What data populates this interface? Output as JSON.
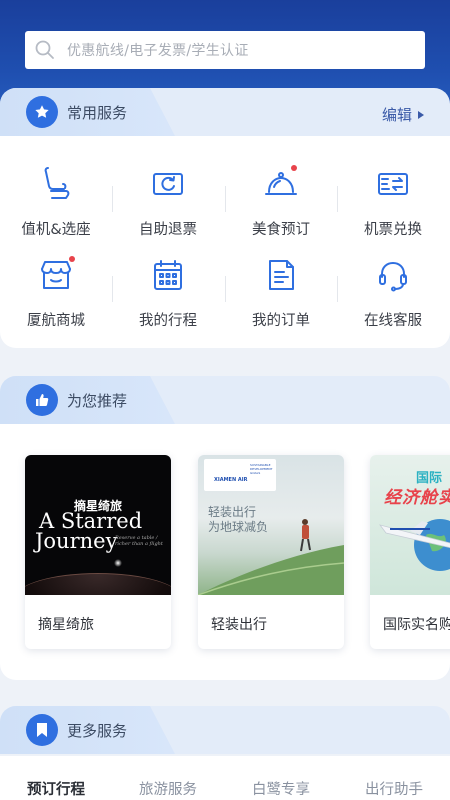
{
  "search": {
    "placeholder": "优惠航线/电子发票/学生认证"
  },
  "common_services": {
    "title": "常用服务",
    "edit_label": "编辑",
    "items": [
      {
        "label": "值机&选座",
        "icon": "seat-icon",
        "badge": false
      },
      {
        "label": "自助退票",
        "icon": "refund-ticket-icon",
        "badge": false
      },
      {
        "label": "美食预订",
        "icon": "food-cloche-icon",
        "badge": true
      },
      {
        "label": "机票兑换",
        "icon": "ticket-exchange-icon",
        "badge": false
      },
      {
        "label": "厦航商城",
        "icon": "shop-icon",
        "badge": true
      },
      {
        "label": "我的行程",
        "icon": "calendar-icon",
        "badge": false
      },
      {
        "label": "我的订单",
        "icon": "order-document-icon",
        "badge": false
      },
      {
        "label": "在线客服",
        "icon": "headset-icon",
        "badge": false
      }
    ]
  },
  "recommend": {
    "title": "为您推荐",
    "cards": [
      {
        "label": "摘星绮旅",
        "image_text": {
          "cn": "摘星绮旅",
          "en1": "A Starred",
          "en2": "Journey",
          "sub": "Reserve a table / richer than a flight"
        }
      },
      {
        "label": "轻装出行",
        "image_text": {
          "cn1": "轻装出行",
          "cn2": "为地球减负",
          "badge": "SUSTAINABLE DEVELOPMENT GOALS",
          "brand": "XIAMEN AIR"
        }
      },
      {
        "label": "国际实名购",
        "image_text": {
          "cn1": "国际",
          "cn2": "经济舱实"
        }
      }
    ]
  },
  "more_services": {
    "title": "更多服务",
    "tabs": [
      "预订行程",
      "旅游服务",
      "白鹭专享",
      "出行助手"
    ],
    "active_tab": 0
  },
  "colors": {
    "brand_blue": "#1f4fb0",
    "accent_icon": "#2f6fe0",
    "badge_red": "#e8434b"
  }
}
